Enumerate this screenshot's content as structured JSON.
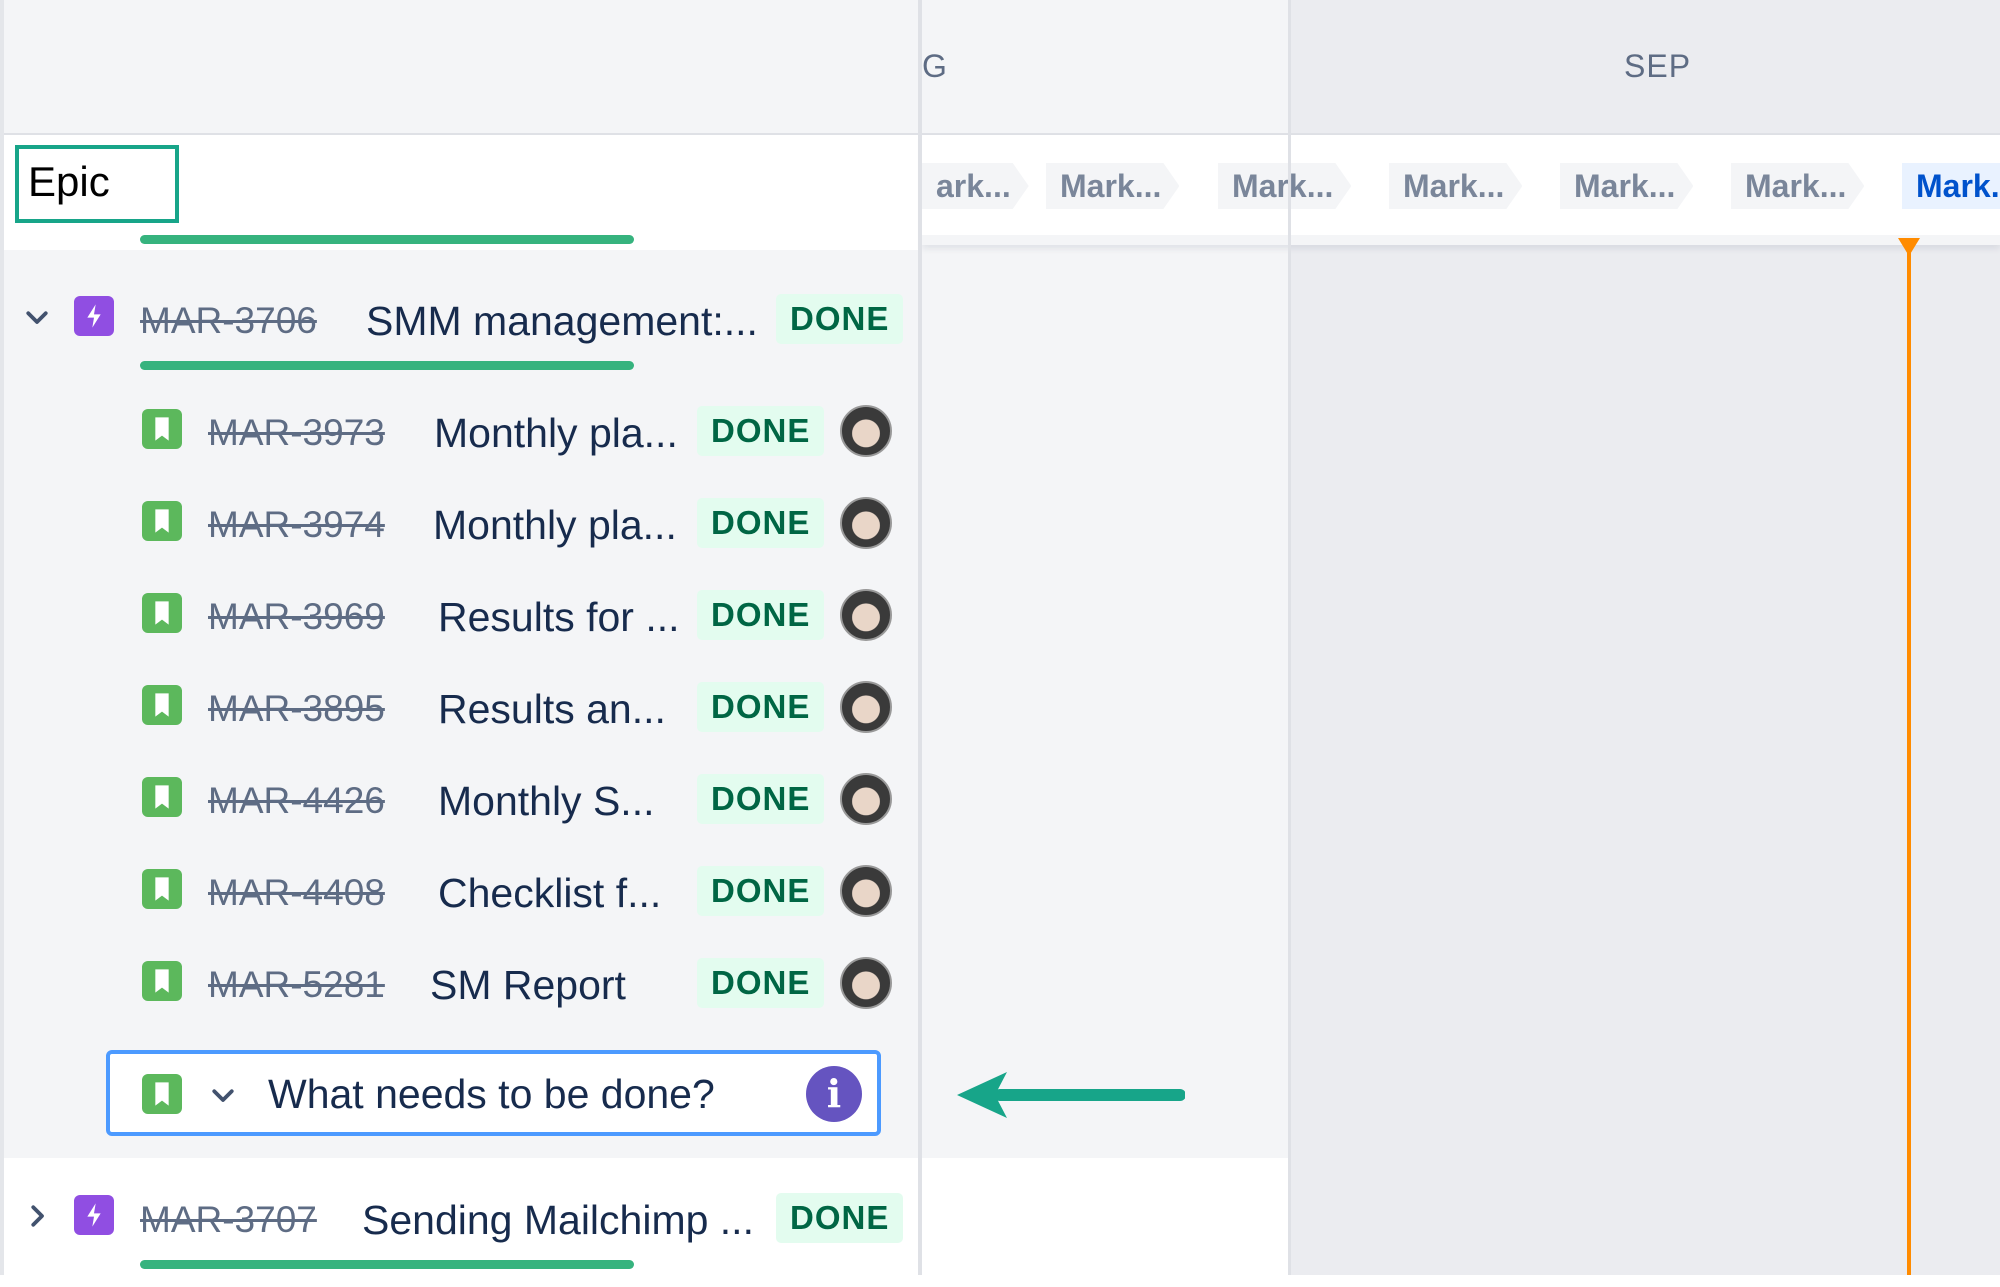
{
  "timeline": {
    "months": [
      "G",
      "SEP"
    ],
    "releases": [
      "ark...",
      "Mark...",
      "Mark...",
      "Mark...",
      "Mark...",
      "Mark...",
      "Mark..."
    ],
    "today_color": "#ff8b00"
  },
  "epic_column": {
    "label": "Epic"
  },
  "epics": [
    {
      "key": "MAR-3706",
      "title": "SMM management:...",
      "status": "DONE",
      "expanded": true,
      "children": [
        {
          "key": "MAR-3973",
          "title": "Monthly pla...",
          "status": "DONE",
          "icon": "story-icon"
        },
        {
          "key": "MAR-3974",
          "title": "Monthly pla...",
          "status": "DONE",
          "icon": "story-icon"
        },
        {
          "key": "MAR-3969",
          "title": "Results for ...",
          "status": "DONE",
          "icon": "story-icon"
        },
        {
          "key": "MAR-3895",
          "title": "Results an...",
          "status": "DONE",
          "icon": "story-icon"
        },
        {
          "key": "MAR-4426",
          "title": "Monthly S...",
          "status": "DONE",
          "icon": "story-icon"
        },
        {
          "key": "MAR-4408",
          "title": "Checklist f...",
          "status": "DONE",
          "icon": "story-icon"
        },
        {
          "key": "MAR-5281",
          "title": "SM Report",
          "status": "DONE",
          "icon": "story-icon"
        }
      ]
    },
    {
      "key": "MAR-3707",
      "title": "Sending Mailchimp ...",
      "status": "DONE",
      "expanded": false
    }
  ],
  "new_issue": {
    "placeholder": "What needs to be done?",
    "info": "i"
  },
  "colors": {
    "epic": "#904ee2",
    "story": "#5cb85c",
    "done_bg": "#e3fcef",
    "done_text": "#006644",
    "progress": "#36b37e",
    "focus": "#4c9aff",
    "annotation": "#17a589"
  }
}
